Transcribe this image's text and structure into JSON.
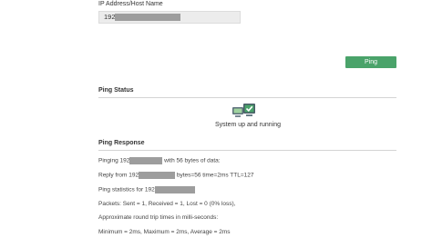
{
  "form": {
    "ip_label": "IP Address/Host Name",
    "ip_value": "192"
  },
  "actions": {
    "ping_label": "Ping"
  },
  "status": {
    "title": "Ping Status",
    "text": "System up and running",
    "icon": "computers-check-icon",
    "accent": "#4aa36a"
  },
  "response": {
    "title": "Ping Response",
    "lines": [
      {
        "before": "Pinging 192",
        "after": "with 56 bytes of data:"
      },
      {
        "before": "Reply from 192",
        "after": "bytes=56 time=2ms TTL=127"
      },
      {
        "before": "Ping statistics for 192",
        "after": ""
      },
      {
        "before": "Packets: Sent = 1, Received = 1, Lost = 0 (0% loss),",
        "after": ""
      },
      {
        "before": "Approximate round trip times in milli-seconds:",
        "after": ""
      },
      {
        "before": "Minimum = 2ms, Maximum = 2ms, Average = 2ms",
        "after": ""
      }
    ]
  }
}
